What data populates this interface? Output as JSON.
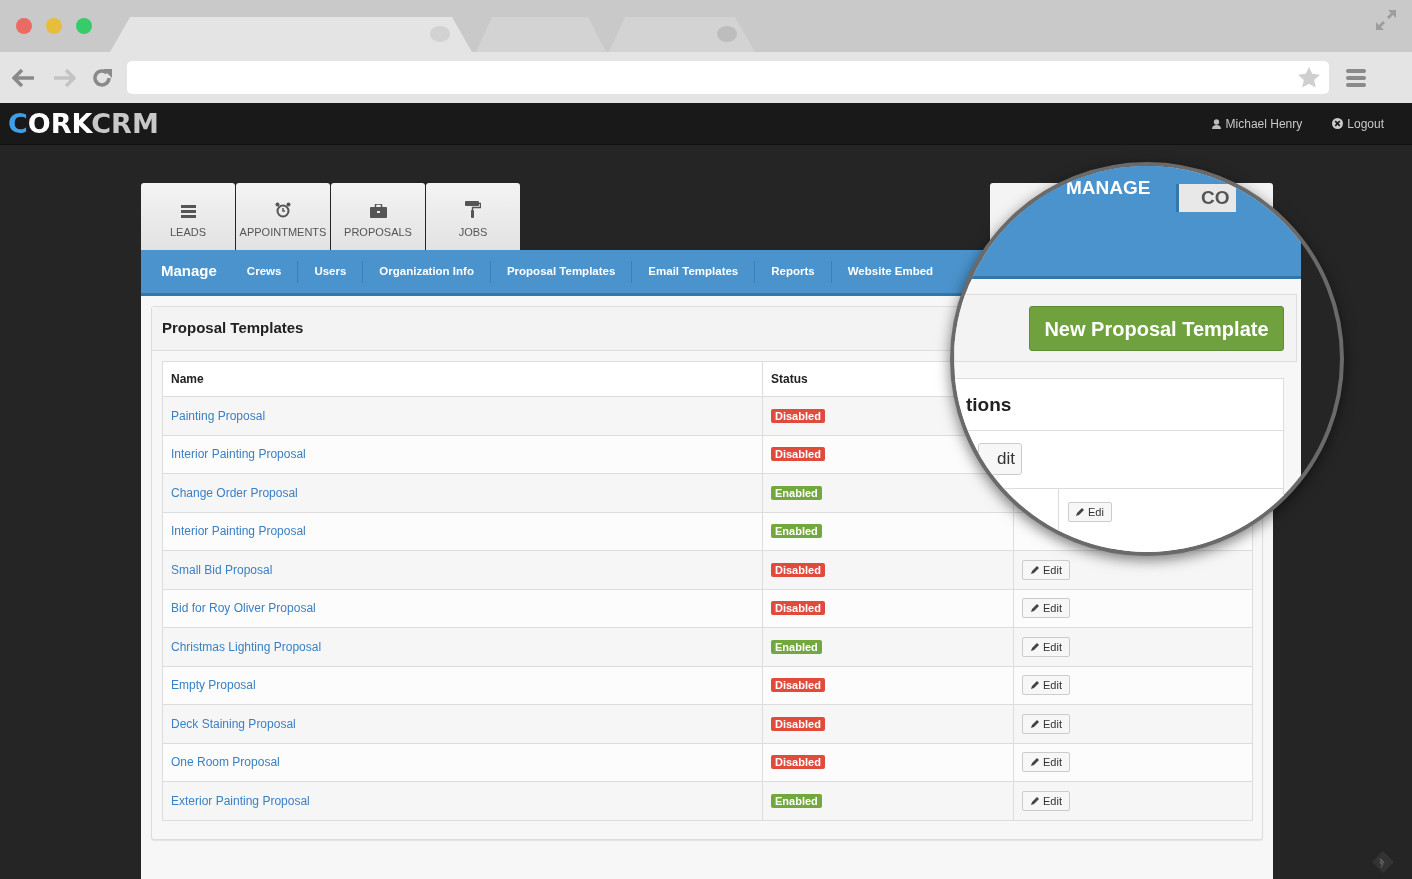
{
  "header": {
    "logo": [
      {
        "text": "C",
        "color": "#3d9fe6"
      },
      {
        "text": "ORK",
        "color": "#ffffff"
      },
      {
        "text": "CRM",
        "color": "#c8c8c8"
      }
    ],
    "user": "Michael Henry",
    "logout": "Logout"
  },
  "app_tabs": [
    {
      "label": "LEADS"
    },
    {
      "label": "APPOINTMENTS"
    },
    {
      "label": "PROPOSALS"
    },
    {
      "label": "JOBS"
    }
  ],
  "subnav": {
    "title": "Manage",
    "links": [
      "Crews",
      "Users",
      "Organization Info",
      "Proposal Templates",
      "Email Templates",
      "Reports",
      "Website Embed"
    ]
  },
  "panel": {
    "title": "Proposal Templates"
  },
  "table": {
    "columns": [
      "Name",
      "Status"
    ],
    "rows": [
      {
        "name": "Painting Proposal",
        "status": "Disabled",
        "enabled": false
      },
      {
        "name": "Interior Painting Proposal",
        "status": "Disabled",
        "enabled": false
      },
      {
        "name": "Change Order Proposal",
        "status": "Enabled",
        "enabled": true
      },
      {
        "name": "Interior Painting Proposal",
        "status": "Enabled",
        "enabled": true
      },
      {
        "name": "Small Bid Proposal",
        "status": "Disabled",
        "enabled": false,
        "action": "Edit"
      },
      {
        "name": "Bid for Roy Oliver Proposal",
        "status": "Disabled",
        "enabled": false,
        "action": "Edit"
      },
      {
        "name": "Christmas Lighting Proposal",
        "status": "Enabled",
        "enabled": true,
        "action": "Edit"
      },
      {
        "name": "Empty Proposal",
        "status": "Disabled",
        "enabled": false,
        "action": "Edit"
      },
      {
        "name": "Deck Staining Proposal",
        "status": "Disabled",
        "enabled": false,
        "action": "Edit"
      },
      {
        "name": "One Room Proposal",
        "status": "Disabled",
        "enabled": false,
        "action": "Edit"
      },
      {
        "name": "Exterior Painting Proposal",
        "status": "Enabled",
        "enabled": true,
        "action": "Edit"
      }
    ]
  },
  "magnifier": {
    "tabs": [
      {
        "label": "MANAGE",
        "selected": true
      },
      {
        "label": "CO",
        "selected": false
      }
    ],
    "new_button": "New Proposal Template",
    "heading": "tions",
    "edit_button": "dit",
    "row_button": "Edi"
  }
}
